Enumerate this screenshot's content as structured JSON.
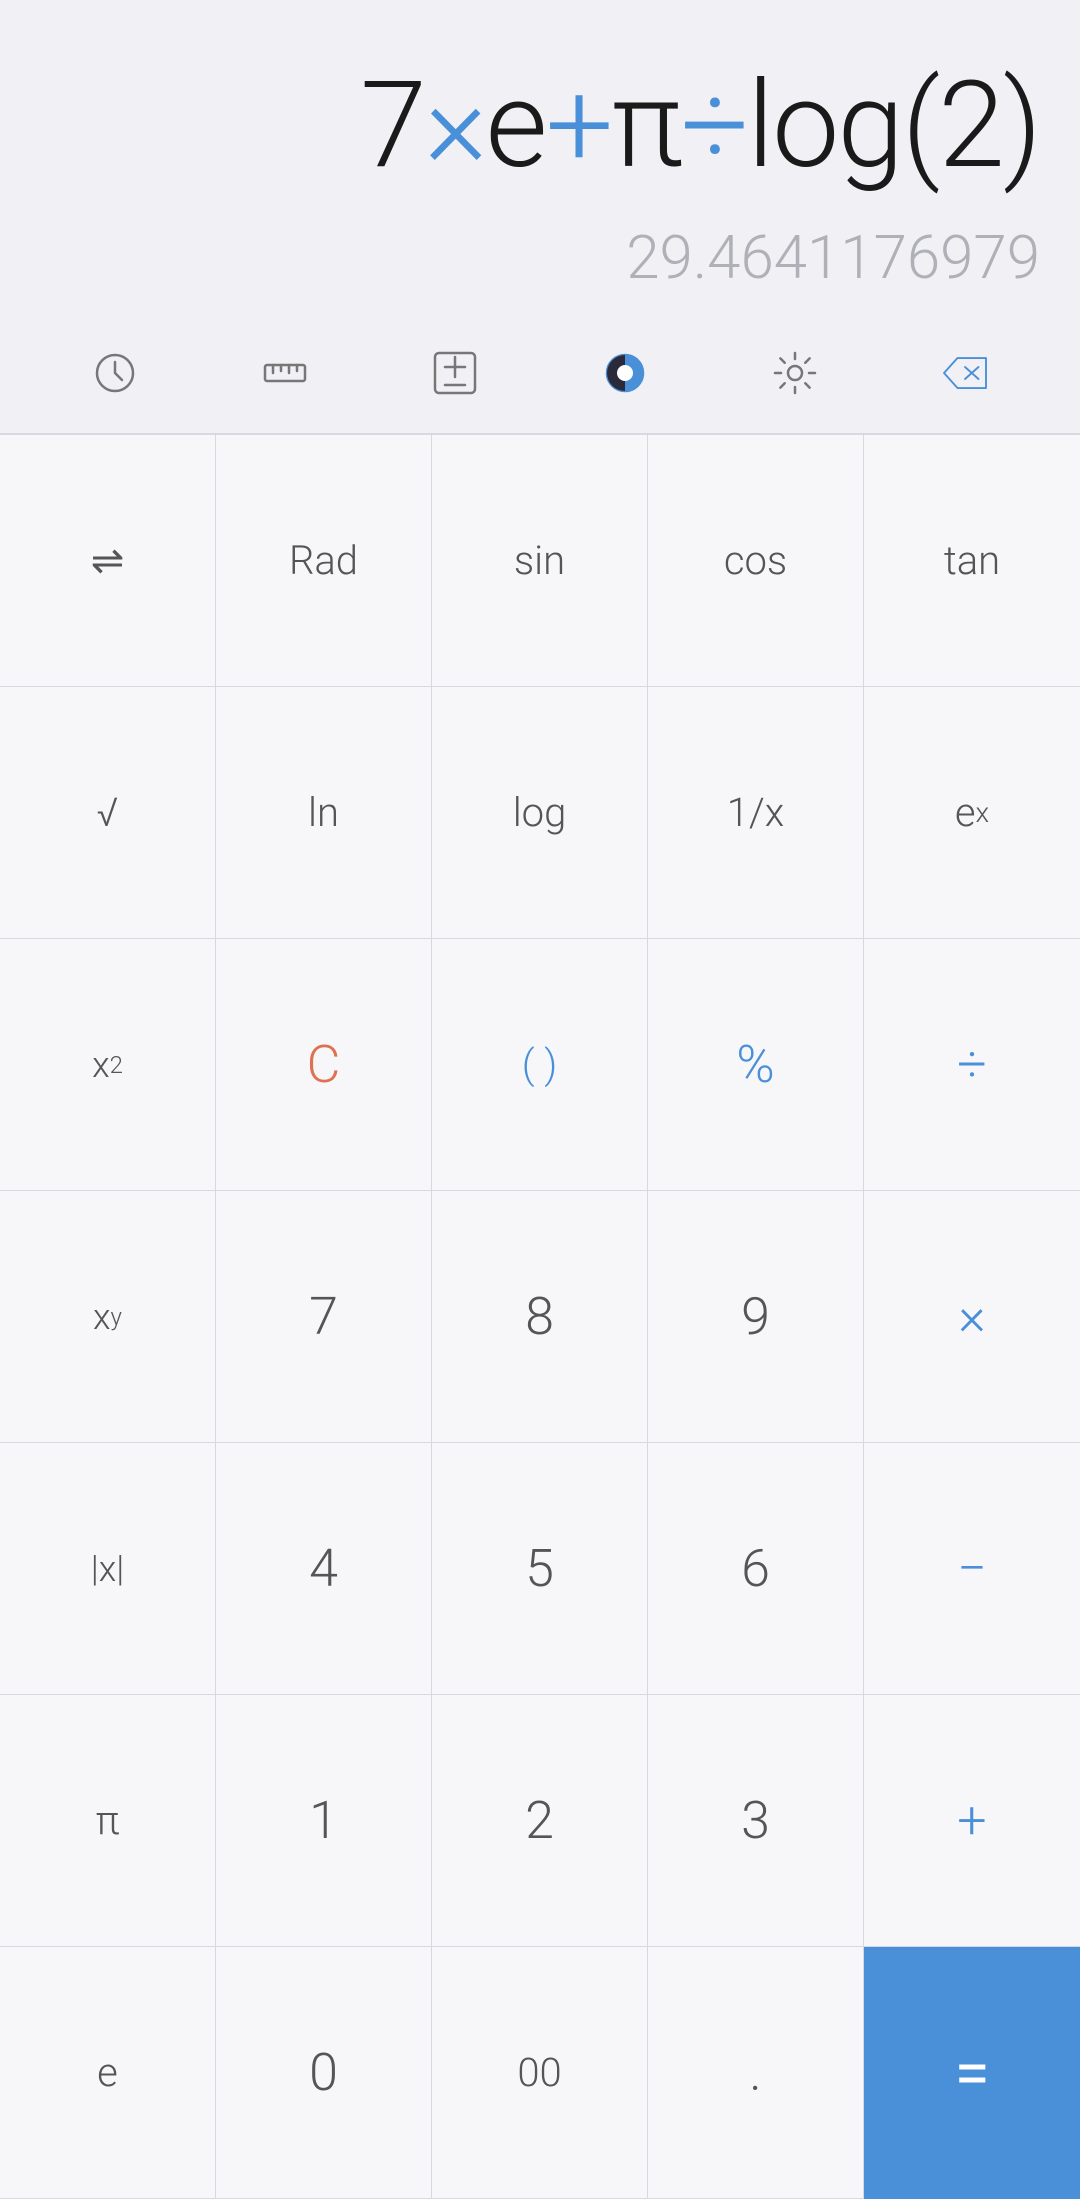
{
  "display": {
    "expression_parts": [
      {
        "text": "7",
        "type": "normal"
      },
      {
        "text": "×",
        "type": "blue"
      },
      {
        "text": "e",
        "type": "normal"
      },
      {
        "text": "+",
        "type": "blue"
      },
      {
        "text": "π",
        "type": "normal"
      },
      {
        "text": "÷",
        "type": "blue"
      },
      {
        "text": "log(2)",
        "type": "normal"
      }
    ],
    "expression_html": "7<span class=\"blue\">×</span>e<span class=\"blue\">+</span>π<span class=\"blue\">÷</span>log(2)",
    "result": "29.4641176979"
  },
  "toolbar": {
    "history_label": "history",
    "ruler_label": "ruler",
    "plusminus_label": "plus-minus",
    "theme_label": "theme",
    "settings_label": "settings",
    "backspace_label": "backspace"
  },
  "keypad": {
    "rows": [
      [
        {
          "label": "⇌",
          "type": "normal",
          "name": "shift"
        },
        {
          "label": "Rad",
          "type": "normal",
          "name": "rad"
        },
        {
          "label": "sin",
          "type": "normal",
          "name": "sin"
        },
        {
          "label": "cos",
          "type": "normal",
          "name": "cos"
        },
        {
          "label": "tan",
          "type": "normal",
          "name": "tan"
        }
      ],
      [
        {
          "label": "√",
          "type": "normal",
          "name": "sqrt"
        },
        {
          "label": "ln",
          "type": "normal",
          "name": "ln"
        },
        {
          "label": "log",
          "type": "normal",
          "name": "log"
        },
        {
          "label": "1/x",
          "type": "normal",
          "name": "inverse"
        },
        {
          "label": "eˣ",
          "type": "normal",
          "name": "exp"
        }
      ],
      [
        {
          "label": "x²",
          "type": "normal",
          "name": "square"
        },
        {
          "label": "C",
          "type": "orange",
          "name": "clear"
        },
        {
          "label": "( )",
          "type": "blue",
          "name": "parentheses"
        },
        {
          "label": "%",
          "type": "blue",
          "name": "percent"
        },
        {
          "label": "÷",
          "type": "blue",
          "name": "divide"
        }
      ],
      [
        {
          "label": "xʸ",
          "type": "normal",
          "name": "power"
        },
        {
          "label": "7",
          "type": "normal",
          "name": "seven"
        },
        {
          "label": "8",
          "type": "normal",
          "name": "eight"
        },
        {
          "label": "9",
          "type": "normal",
          "name": "nine"
        },
        {
          "label": "×",
          "type": "blue",
          "name": "multiply"
        }
      ],
      [
        {
          "label": "|x|",
          "type": "normal",
          "name": "abs"
        },
        {
          "label": "4",
          "type": "normal",
          "name": "four"
        },
        {
          "label": "5",
          "type": "normal",
          "name": "five"
        },
        {
          "label": "6",
          "type": "normal",
          "name": "six"
        },
        {
          "label": "−",
          "type": "blue",
          "name": "subtract"
        }
      ],
      [
        {
          "label": "π",
          "type": "normal",
          "name": "pi"
        },
        {
          "label": "1",
          "type": "normal",
          "name": "one"
        },
        {
          "label": "2",
          "type": "normal",
          "name": "two"
        },
        {
          "label": "3",
          "type": "normal",
          "name": "three"
        },
        {
          "label": "+",
          "type": "blue",
          "name": "add"
        }
      ],
      [
        {
          "label": "e",
          "type": "normal",
          "name": "euler"
        },
        {
          "label": "0",
          "type": "normal",
          "name": "zero"
        },
        {
          "label": "00",
          "type": "normal",
          "name": "double-zero"
        },
        {
          "label": ".",
          "type": "normal",
          "name": "decimal"
        },
        {
          "label": "=",
          "type": "equals",
          "name": "equals"
        }
      ]
    ]
  },
  "colors": {
    "blue": "#4a90d9",
    "orange": "#e07050",
    "background": "#f0f0f5",
    "key_bg": "#f7f7fa",
    "border": "#d8d8e0",
    "result_color": "#b0b0b8"
  }
}
